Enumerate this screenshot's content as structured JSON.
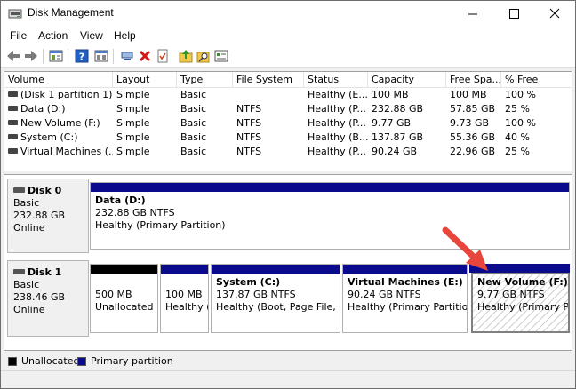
{
  "window": {
    "title": "Disk Management"
  },
  "menu": [
    "File",
    "Action",
    "View",
    "Help"
  ],
  "toolbar": {
    "icons": [
      "back-arrow-icon",
      "forward-arrow-icon",
      "properties-icon",
      "help-icon",
      "console-view-icon",
      "connect-icon",
      "delete-icon",
      "check-icon",
      "folder-up-icon",
      "search-folder-icon",
      "settings-list-icon"
    ]
  },
  "volume_table": {
    "columns": [
      "Volume",
      "Layout",
      "Type",
      "File System",
      "Status",
      "Capacity",
      "Free Spa...",
      "% Free"
    ],
    "rows": [
      [
        "(Disk 1 partition 1)",
        "Simple",
        "Basic",
        "",
        "Healthy (E...",
        "100 MB",
        "100 MB",
        "100 %"
      ],
      [
        "Data (D:)",
        "Simple",
        "Basic",
        "NTFS",
        "Healthy (P...",
        "232.88 GB",
        "57.85 GB",
        "25 %"
      ],
      [
        "New Volume (F:)",
        "Simple",
        "Basic",
        "NTFS",
        "Healthy (P...",
        "9.77 GB",
        "9.73 GB",
        "100 %"
      ],
      [
        "System (C:)",
        "Simple",
        "Basic",
        "NTFS",
        "Healthy (B...",
        "137.87 GB",
        "55.36 GB",
        "40 %"
      ],
      [
        "Virtual Machines (...",
        "Simple",
        "Basic",
        "NTFS",
        "Healthy (P...",
        "90.24 GB",
        "22.96 GB",
        "25 %"
      ]
    ]
  },
  "disks": [
    {
      "name": "Disk 0",
      "type": "Basic",
      "size": "232.88 GB",
      "state": "Online",
      "partitions": [
        {
          "name": "Data  (D:)",
          "size_fs": "232.88 GB NTFS",
          "status": "Healthy (Primary Partition)"
        }
      ]
    },
    {
      "name": "Disk 1",
      "type": "Basic",
      "size": "238.46 GB",
      "state": "Online",
      "partitions": [
        {
          "name": "",
          "size_fs": "500 MB",
          "status": "Unallocated"
        },
        {
          "name": "",
          "size_fs": "100 MB",
          "status": "Healthy ("
        },
        {
          "name": "System  (C:)",
          "size_fs": "137.87 GB NTFS",
          "status": "Healthy (Boot, Page File, Cr"
        },
        {
          "name": "Virtual Machines  (E:)",
          "size_fs": "90.24 GB NTFS",
          "status": "Healthy (Primary Partition"
        },
        {
          "name": "New Volume  (F:)",
          "size_fs": "9.77 GB NTFS",
          "status": "Healthy (Primary Par"
        }
      ]
    }
  ],
  "legend": {
    "unallocated": "Unallocated",
    "primary": "Primary partition"
  },
  "colors": {
    "primary_partition": "#0a0a8c",
    "unallocated": "#000000",
    "annotation_arrow": "#e8463c"
  }
}
